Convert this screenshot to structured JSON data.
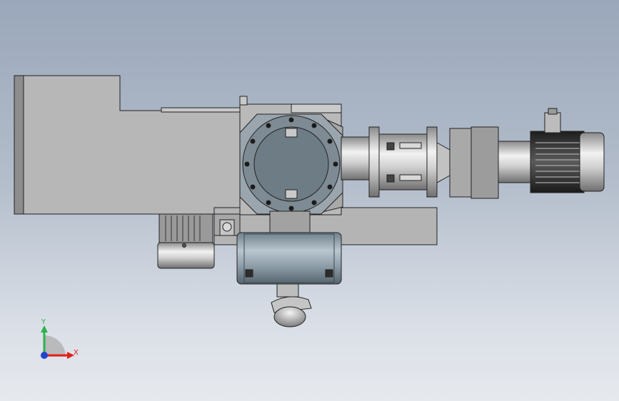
{
  "viewport": {
    "background_top": "#9aa7ba",
    "background_bottom": "#e6e9ee"
  },
  "triad": {
    "x_label": "X",
    "y_label": "Y",
    "x_color": "#e0211b",
    "y_color": "#2bb34a",
    "origin_color": "#2244cc"
  },
  "colors": {
    "body_gray": "#b9b9b9",
    "dark_gray": "#8d8d8d",
    "light_gray": "#d6d6d6",
    "steel_blue": "#8797a3",
    "motor_dark": "#2a2a2a",
    "outline": "#222222"
  }
}
